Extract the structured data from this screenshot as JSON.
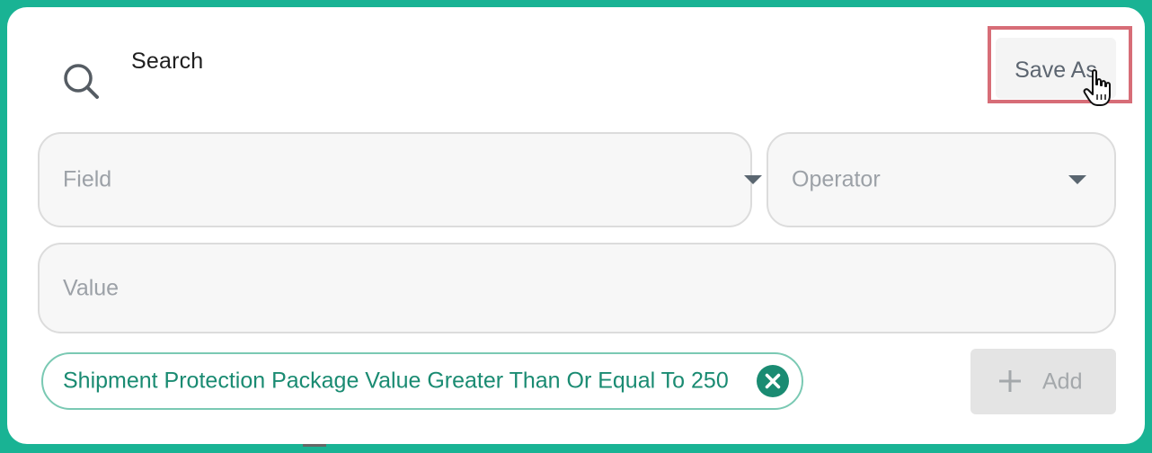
{
  "header": {
    "title": "Search",
    "save_as_label": "Save As"
  },
  "form": {
    "field_placeholder": "Field",
    "operator_placeholder": "Operator",
    "value_placeholder": "Value"
  },
  "filters": [
    {
      "label": "Shipment Protection Package Value Greater Than Or Equal To 250"
    }
  ],
  "actions": {
    "add_label": "Add"
  },
  "colors": {
    "frame": "#19b394",
    "accent": "#1a8b72",
    "highlight": "#d76d77"
  },
  "icons": [
    "search-icon",
    "chevron-down-icon",
    "close-icon",
    "plus-icon",
    "hand-cursor-icon"
  ]
}
